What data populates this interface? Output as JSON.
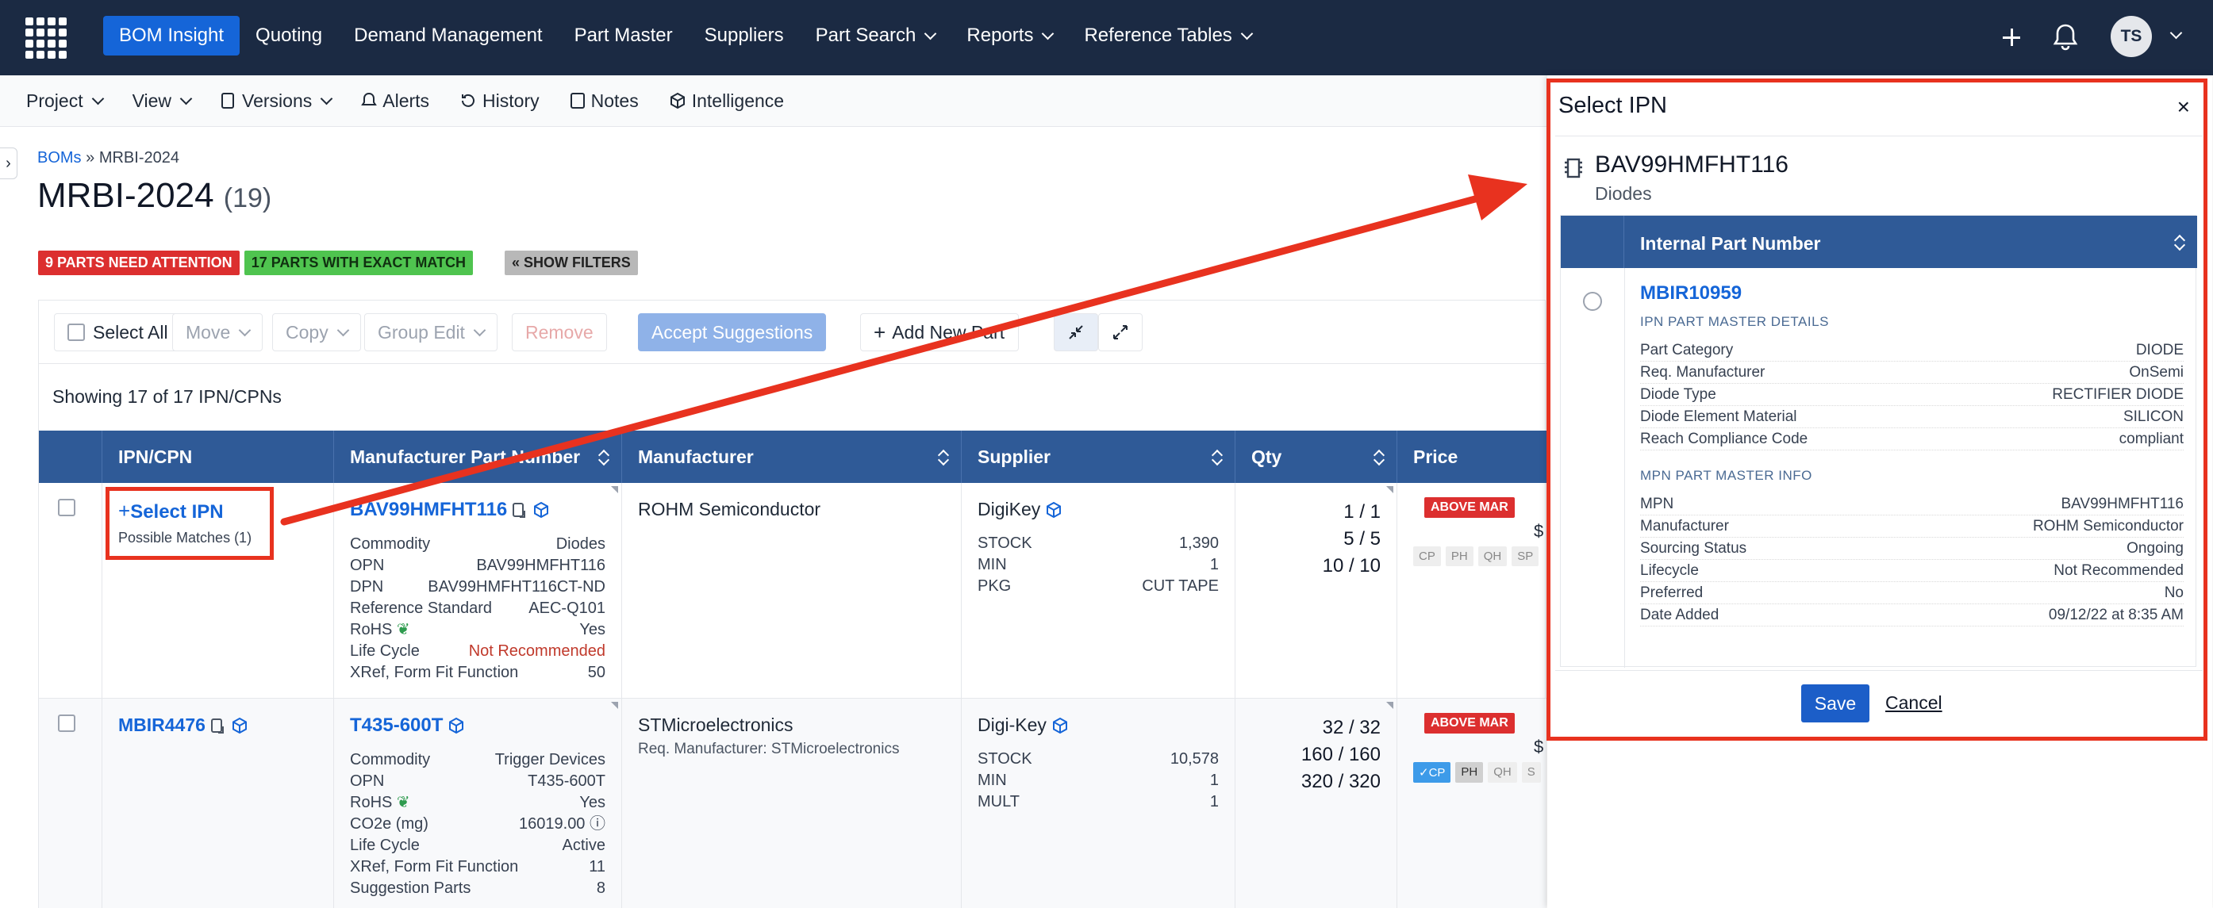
{
  "topnav": {
    "items": [
      "BOM Insight",
      "Quoting",
      "Demand Management",
      "Part Master",
      "Suppliers",
      "Part Search",
      "Reports",
      "Reference Tables"
    ],
    "avatar": "TS"
  },
  "subnav": {
    "items": [
      "Project",
      "View",
      "Versions",
      "Alerts",
      "History",
      "Notes",
      "Intelligence"
    ]
  },
  "breadcrumb": {
    "root": "BOMs",
    "sep": "»",
    "current": "MRBI-2024"
  },
  "page": {
    "title": "MRBI-2024",
    "count": "(19)"
  },
  "badges": {
    "attention": "9 PARTS NEED ATTENTION",
    "exact": "17 PARTS WITH EXACT MATCH",
    "filters": "« SHOW FILTERS"
  },
  "toolbar": {
    "select_all": "Select All",
    "move": "Move",
    "copy": "Copy",
    "group_edit": "Group Edit",
    "remove": "Remove",
    "accept": "Accept Suggestions",
    "add_part": "Add New Part"
  },
  "grid": {
    "showing": "Showing 17 of 17 IPN/CPNs",
    "headers": [
      "IPN/CPN",
      "Manufacturer Part Number",
      "Manufacturer",
      "Supplier",
      "Qty",
      "Price"
    ],
    "rows": [
      {
        "ipn": "Select IPN",
        "ipn_sub": "Possible Matches (1)",
        "mpn": "BAV99HMFHT116",
        "details": [
          [
            "Commodity",
            "Diodes"
          ],
          [
            "OPN",
            "BAV99HMFHT116"
          ],
          [
            "DPN",
            "BAV99HMFHT116CT-ND"
          ],
          [
            "Reference Standard",
            "AEC-Q101"
          ],
          [
            "RoHS",
            "Yes"
          ],
          [
            "Life Cycle",
            "Not Recommended"
          ],
          [
            "XRef, Form Fit Function",
            "50"
          ]
        ],
        "manufacturer": "ROHM Semiconductor",
        "manufacturer_sub": "",
        "supplier": "DigiKey",
        "supplier_details": [
          [
            "STOCK",
            "1,390"
          ],
          [
            "MIN",
            "1"
          ],
          [
            "PKG",
            "CUT TAPE"
          ]
        ],
        "qty": [
          "1 / 1",
          "5 / 5",
          "10 / 10"
        ],
        "price_badge": "ABOVE MAR",
        "price": "$",
        "chips": [
          "CP",
          "PH",
          "QH",
          "SP"
        ]
      },
      {
        "ipn": "MBIR4476",
        "ipn_sub": "",
        "mpn": "T435-600T",
        "details": [
          [
            "Commodity",
            "Trigger Devices"
          ],
          [
            "OPN",
            "T435-600T"
          ],
          [
            "RoHS",
            "Yes"
          ],
          [
            "CO2e (mg)",
            "16019.00"
          ],
          [
            "Life Cycle",
            "Active"
          ],
          [
            "XRef, Form Fit Function",
            "11"
          ],
          [
            "Suggestion Parts",
            "8"
          ]
        ],
        "manufacturer": "STMicroelectronics",
        "manufacturer_sub": "Req. Manufacturer: STMicroelectronics",
        "supplier": "Digi-Key",
        "supplier_details": [
          [
            "STOCK",
            "10,578"
          ],
          [
            "MIN",
            "1"
          ],
          [
            "MULT",
            "1"
          ]
        ],
        "qty": [
          "32 / 32",
          "160 / 160",
          "320 / 320"
        ],
        "price_badge": "ABOVE MAR",
        "price": "$",
        "chips": [
          "CP",
          "PH",
          "QH",
          "S"
        ]
      }
    ]
  },
  "modal": {
    "title": "Select IPN",
    "close": "×",
    "part": "BAV99HMFHT116",
    "part_sub": "Diodes",
    "column": "Internal Part Number",
    "ipn": "MBIR10959",
    "sec1": "IPN PART MASTER DETAILS",
    "details1": [
      [
        "Part Category",
        "DIODE"
      ],
      [
        "Req. Manufacturer",
        "OnSemi"
      ],
      [
        "Diode Type",
        "RECTIFIER DIODE"
      ],
      [
        "Diode Element Material",
        "SILICON"
      ],
      [
        "Reach Compliance Code",
        "compliant"
      ]
    ],
    "sec2": "MPN PART MASTER INFO",
    "details2": [
      [
        "MPN",
        "BAV99HMFHT116"
      ],
      [
        "Manufacturer",
        "ROHM Semiconductor"
      ],
      [
        "Sourcing Status",
        "Ongoing"
      ],
      [
        "Lifecycle",
        "Not Recommended"
      ],
      [
        "Preferred",
        "No"
      ],
      [
        "Date Added",
        "09/12/22 at 8:35 AM"
      ]
    ],
    "save": "Save",
    "cancel": "Cancel"
  },
  "colors": {
    "nav_bg": "#1b2a43",
    "accent": "#1565d8",
    "header_bg": "#2f5a97",
    "annotation": "#e8321f"
  }
}
